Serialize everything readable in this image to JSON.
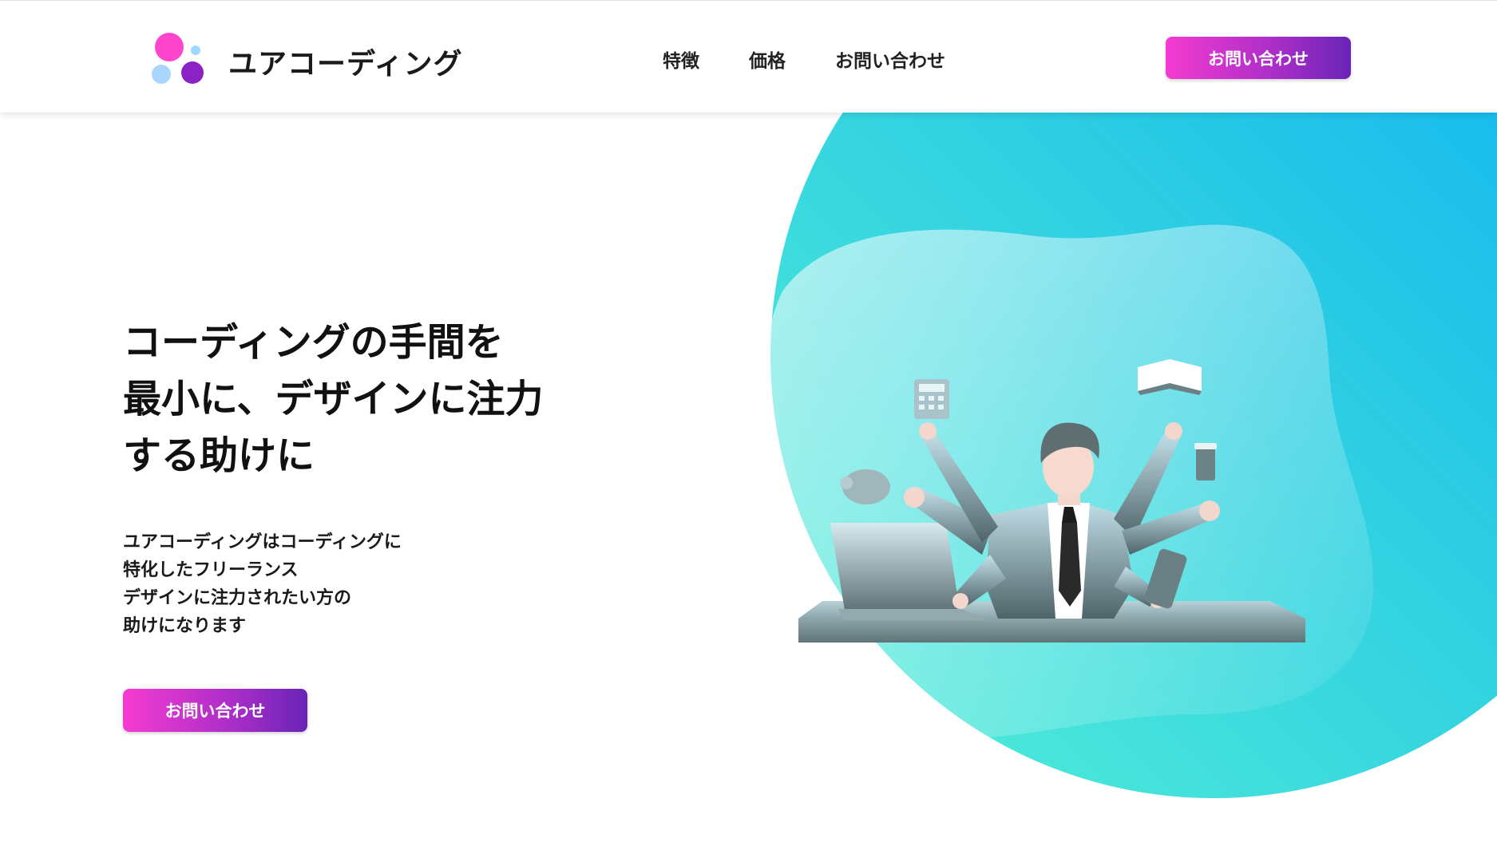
{
  "brand": {
    "name": "ユアコーディング",
    "logo_icon": "four-dots-logo-icon"
  },
  "nav": {
    "items": [
      "特徴",
      "価格",
      "お問い合わせ"
    ]
  },
  "header": {
    "cta_label": "お問い合わせ"
  },
  "hero": {
    "title_lines": [
      "コーディングの手間を",
      "最小に、デザインに注力",
      "する助けに"
    ],
    "description_lines": [
      "ユアコーディングはコーディングに",
      "特化したフリーランス",
      "デザインに注力されたい方の",
      "助けになります"
    ],
    "cta_label": "お問い合わせ",
    "illustration": "multitasking-businessman-illustration"
  },
  "colors": {
    "button_gradient_start": "#f43bd0",
    "button_gradient_end": "#6a24b8",
    "blob_gradient_start": "#55f0d6",
    "blob_gradient_end": "#0aaef5"
  }
}
